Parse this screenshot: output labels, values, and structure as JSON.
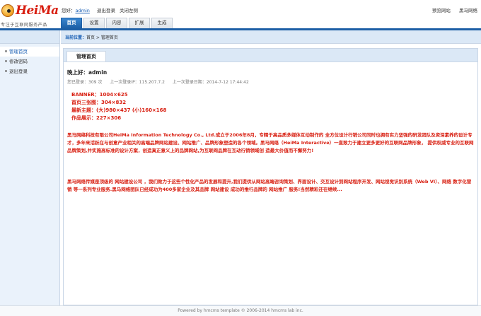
{
  "header": {
    "logo_text": "HeiMa",
    "slogan": "专注于互联网服务产品",
    "greeting_prefix": "您好：",
    "username": "admin",
    "logout_link": "退出登录",
    "close_menu_link": "关闭左侧",
    "preview_site": "预览网站",
    "heima_network": "黑马网络"
  },
  "nav": {
    "tabs": [
      {
        "label": "首页",
        "active": true
      },
      {
        "label": "设置",
        "active": false
      },
      {
        "label": "内容",
        "active": false
      },
      {
        "label": "扩展",
        "active": false
      },
      {
        "label": "生成",
        "active": false
      }
    ]
  },
  "sidebar": {
    "items": [
      {
        "label": "管理首页",
        "active": true
      },
      {
        "label": "修改密码",
        "active": false
      },
      {
        "label": "退出登录",
        "active": false
      }
    ]
  },
  "breadcrumb": {
    "label": "当前位置：",
    "path": "首页 > 管理首页"
  },
  "panel": {
    "tab_label": "管理首页",
    "greeting": "晚上好：admin",
    "login_count": "您已登录：309 次",
    "last_ip": "上一次登录IP：115.207.7.2",
    "last_date": "上一次登录日期：2014-7-12 17:44:42",
    "specs": [
      "BANNER：1004×625",
      "首页三张图：304×832",
      "最新主题：(大)980×437 (小)160×168",
      "作品展示：227×306"
    ],
    "para1": "黑马网络科技有限公司HeiMa Information Technology Co., Ltd.成立于2006年8月，专精于高品质多媒体互动制作的 全方位设计行销公司同时也拥有实力坚强的研发团队及资深素养的设计专才，多年来活跃在与创意产业相关的高端品牌网站建设、网站推广、品牌形象塑造的各个领域。黑马网络（HeiMa Interactive）一直致力于建立更多更好的互联网品牌形象， 提供权威专业的互联网品牌策划,并实施高标准的设计方案，创造真正意义上的品牌网站,为互联网品牌在互动行销领域创 造最大价值而不懈努力!",
    "para2": "黑马网络传媒是顶级的 网站建设公司 ，我们致力于这些个性化产品的发展和提升,我们提供从网站高端咨询策划、界面设计、交互设计到网站程序开发、网站视觉识别系统（Web VI）、网络 数字化营销 等一系列专业服务.黑马网络团队已经成功为400多家企业及其品牌 网站建设 成功的推行品牌的 网站推广 服务!当然精彩还在继续..."
  },
  "footer": {
    "text": "Powered by hmcms template © 2006-2014 hmcms lab inc."
  },
  "colors": {
    "accent": "#1d5fa6",
    "highlight_text": "#d81e10",
    "sidebar_bg": "#eaf2fb"
  }
}
